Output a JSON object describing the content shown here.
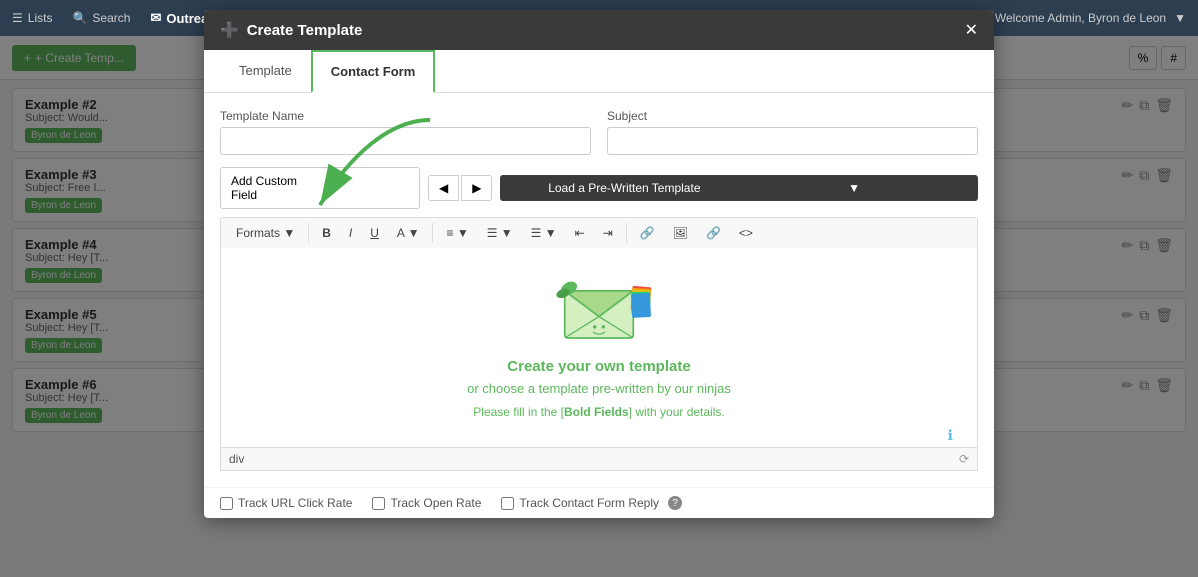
{
  "navbar": {
    "lists_label": "Lists",
    "search_label": "Search",
    "brand_label": "Outreach",
    "welcome_text": "Welcome Admin, Byron de Leon"
  },
  "background": {
    "create_button": "+ Create Temp...",
    "toolbar_buttons": [
      "%",
      "#"
    ],
    "list_items": [
      {
        "title": "Example #2",
        "subject": "Subject: Would...",
        "tag": "Byron de Leon"
      },
      {
        "title": "Example #3",
        "subject": "Subject: Free I...",
        "tag": "Byron de Leon"
      },
      {
        "title": "Example #4",
        "subject": "Subject: Hey [T...",
        "tag": "Byron de Leon"
      },
      {
        "title": "Example #5",
        "subject": "Subject: Hey [T...",
        "tag": "Byron de Leon"
      },
      {
        "title": "Example #6",
        "subject": "Subject: Hey [T...",
        "tag": "Byron de Leon"
      }
    ]
  },
  "modal": {
    "title": "Create Template",
    "title_icon": "➕",
    "close_icon": "✕",
    "tabs": [
      {
        "id": "template",
        "label": "Template"
      },
      {
        "id": "contact_form",
        "label": "Contact Form"
      }
    ],
    "form": {
      "template_name_label": "Template Name",
      "template_name_placeholder": "",
      "subject_label": "Subject",
      "subject_placeholder": "",
      "custom_field_label": "Add Custom Field",
      "nav_prev": "◀",
      "nav_next": "▶",
      "prewritten_label": "Load a Pre-Written Template",
      "prewritten_icon": "▼"
    },
    "editor_toolbar": {
      "formats": "Formats",
      "bold": "B",
      "italic": "I",
      "underline": "U",
      "font_color": "A",
      "align": "≡",
      "list_ul": "☰",
      "list_ol": "☰",
      "indent_left": "⇤",
      "indent_right": "⇥",
      "link": "🔗",
      "image": "🖼",
      "url": "🔗",
      "code": "<>"
    },
    "editor_content": {
      "heading": "Create your own template",
      "subheading": "or choose a template pre-written by our ninjas",
      "note": "Please fill in the [Bold Fields] with your details."
    },
    "code_bar": {
      "text": "div"
    },
    "footer": {
      "track_url": "Track URL Click Rate",
      "track_open": "Track Open Rate",
      "track_contact": "Track Contact Form Reply",
      "help_icon": "?"
    }
  },
  "colors": {
    "green": "#5cb85c",
    "dark": "#3a3a3a",
    "navbar_bg": "#2c3e50",
    "tab_active_border": "#5cb85c"
  }
}
